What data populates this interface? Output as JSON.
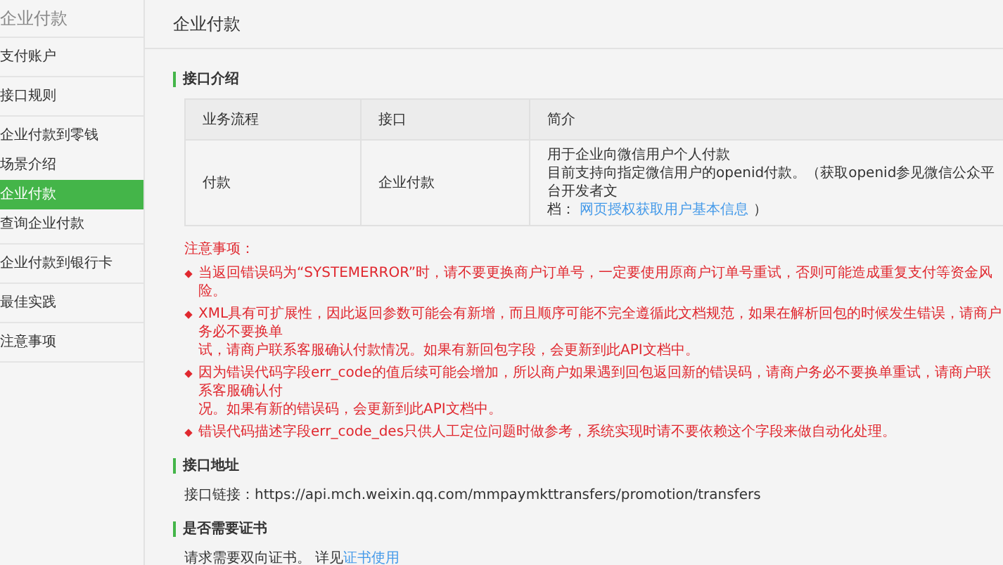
{
  "sidebar": {
    "title": "企业付款",
    "items": [
      {
        "label": "支付账户",
        "selected": false
      },
      {
        "label": "接口规则",
        "selected": false
      },
      {
        "label": "企业付款到零钱",
        "selected": false,
        "children": [
          {
            "label": "场景介绍",
            "selected": false
          },
          {
            "label": "企业付款",
            "selected": true
          },
          {
            "label": "查询企业付款",
            "selected": false
          }
        ]
      },
      {
        "label": "企业付款到银行卡",
        "selected": false
      },
      {
        "label": "最佳实践",
        "selected": false
      },
      {
        "label": "注意事项",
        "selected": false
      }
    ]
  },
  "page_title": "企业付款",
  "interface_intro": {
    "title": "接口介绍",
    "table": {
      "columns": [
        "业务流程",
        "接口",
        "简介"
      ],
      "rows": [
        {
          "process": "付款",
          "interface": "企业付款",
          "description": {
            "lines": [
              "用于企业向微信用户个人付款",
              "目前支持向指定微信用户的openid付款。（获取openid参见微信公众平台开发者文"
            ],
            "last_prefix": "档：",
            "link": "网页授权获取用户基本信息",
            "last_suffix": "）"
          }
        }
      ]
    }
  },
  "notes": {
    "title": "注意事项：",
    "items": [
      {
        "lines": [
          "当返回错误码为“SYSTEMERROR”时，请不要更换商户订单号，一定要使用原商户订单号重试，否则可能造成重复支付等资金风险。"
        ]
      },
      {
        "lines": [
          "XML具有可扩展性，因此返回参数可能会有新增，而且顺序可能不完全遵循此文档规范，如果在解析回包的时候发生错误，请商户务必不要换单",
          "试，请商户联系客服确认付款情况。如果有新回包字段，会更新到此API文档中。"
        ]
      },
      {
        "lines": [
          "因为错误代码字段err_code的值后续可能会增加，所以商户如果遇到回包返回新的错误码，请商户务必不要换单重试，请商户联系客服确认付",
          "况。如果有新的错误码，会更新到此API文档中。"
        ]
      },
      {
        "lines": [
          "错误代码描述字段err_code_des只供人工定位问题时做参考，系统实现时请不要依赖这个字段来做自动化处理。"
        ]
      }
    ]
  },
  "interface_address": {
    "title": "接口地址",
    "text": "接口链接：https://api.mch.weixin.qq.com/mmpaymkttransfers/promotion/transfers"
  },
  "certificate": {
    "title": "是否需要证书",
    "text": "请求需要双向证书。 详见",
    "link": "证书使用"
  }
}
